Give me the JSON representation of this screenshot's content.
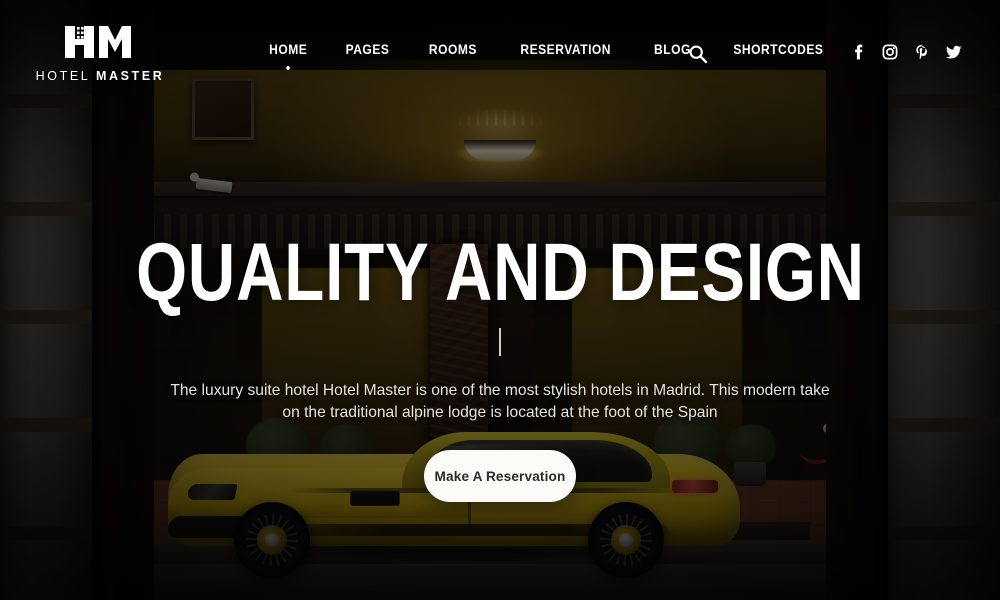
{
  "brand": {
    "mark": "HM",
    "name_bold": "MASTER",
    "name_light": "HOTEL",
    "full_name": "HOTEL MASTER",
    "logo_icon": "hotel-building-icon"
  },
  "nav": {
    "items": [
      {
        "label": "HOME",
        "active": true
      },
      {
        "label": "PAGES",
        "active": false
      },
      {
        "label": "ROOMS",
        "active": false
      },
      {
        "label": "RESERVATION",
        "active": false
      },
      {
        "label": "BLOG",
        "active": false
      },
      {
        "label": "SHORTCODES",
        "active": false
      }
    ],
    "search_icon": "search-icon"
  },
  "social": {
    "items": [
      {
        "name": "facebook-icon",
        "label": "Facebook"
      },
      {
        "name": "instagram-icon",
        "label": "Instagram"
      },
      {
        "name": "pinterest-icon",
        "label": "Pinterest"
      },
      {
        "name": "twitter-icon",
        "label": "Twitter"
      }
    ]
  },
  "hero": {
    "title": "QUALITY AND DESIGN",
    "subtitle": "The luxury suite hotel Hotel Master is one of the most stylish hotels in Madrid. This modern take on the traditional alpine lodge is located at the foot of the Spain",
    "cta_label": "Make A Reservation"
  },
  "colors": {
    "text_light": "#ffffff",
    "subtitle": "#e6e4df",
    "cta_background": "#fcfbf8",
    "cta_text": "#2c2c2c",
    "car_yellow": "#e7c41b",
    "interior_glow": "#e2b024",
    "stone_column": "#6e6b65"
  }
}
